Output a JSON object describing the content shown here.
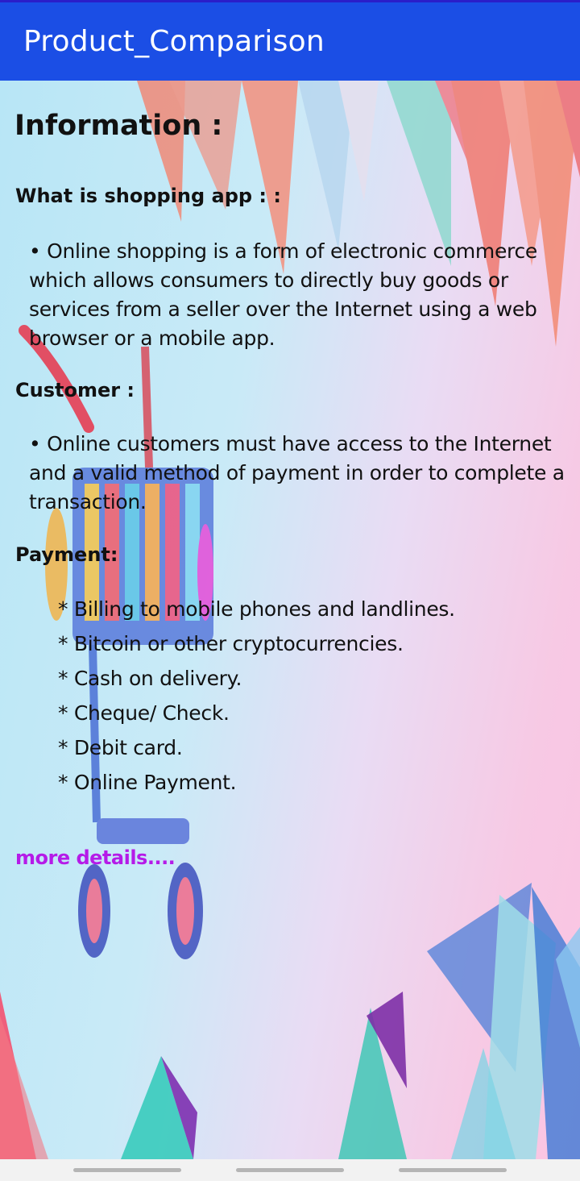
{
  "app_bar": {
    "title": "Product_Comparison"
  },
  "content": {
    "title": "Information :",
    "sections": [
      {
        "heading": "What is shopping app : :",
        "text": "• Online shopping is a form of electronic commerce which allows consumers to directly buy goods or services from a seller over the Internet using a web browser or a mobile app."
      },
      {
        "heading": "Customer :",
        "text": "• Online customers must have access to the Internet and a valid method of payment in order to complete a transaction."
      },
      {
        "heading": "Payment:",
        "items": [
          "* Billing to mobile phones and landlines.",
          "* Bitcoin or other cryptocurrencies.",
          "* Cash on delivery.",
          "* Cheque/ Check.",
          "* Debit card.",
          "* Online Payment."
        ]
      }
    ],
    "more_link": "more details...."
  },
  "colors": {
    "app_bar": "#1b4ee5",
    "link": "#b51be8",
    "text": "#111111"
  },
  "icons": [
    "shopping-cart-illustration"
  ]
}
